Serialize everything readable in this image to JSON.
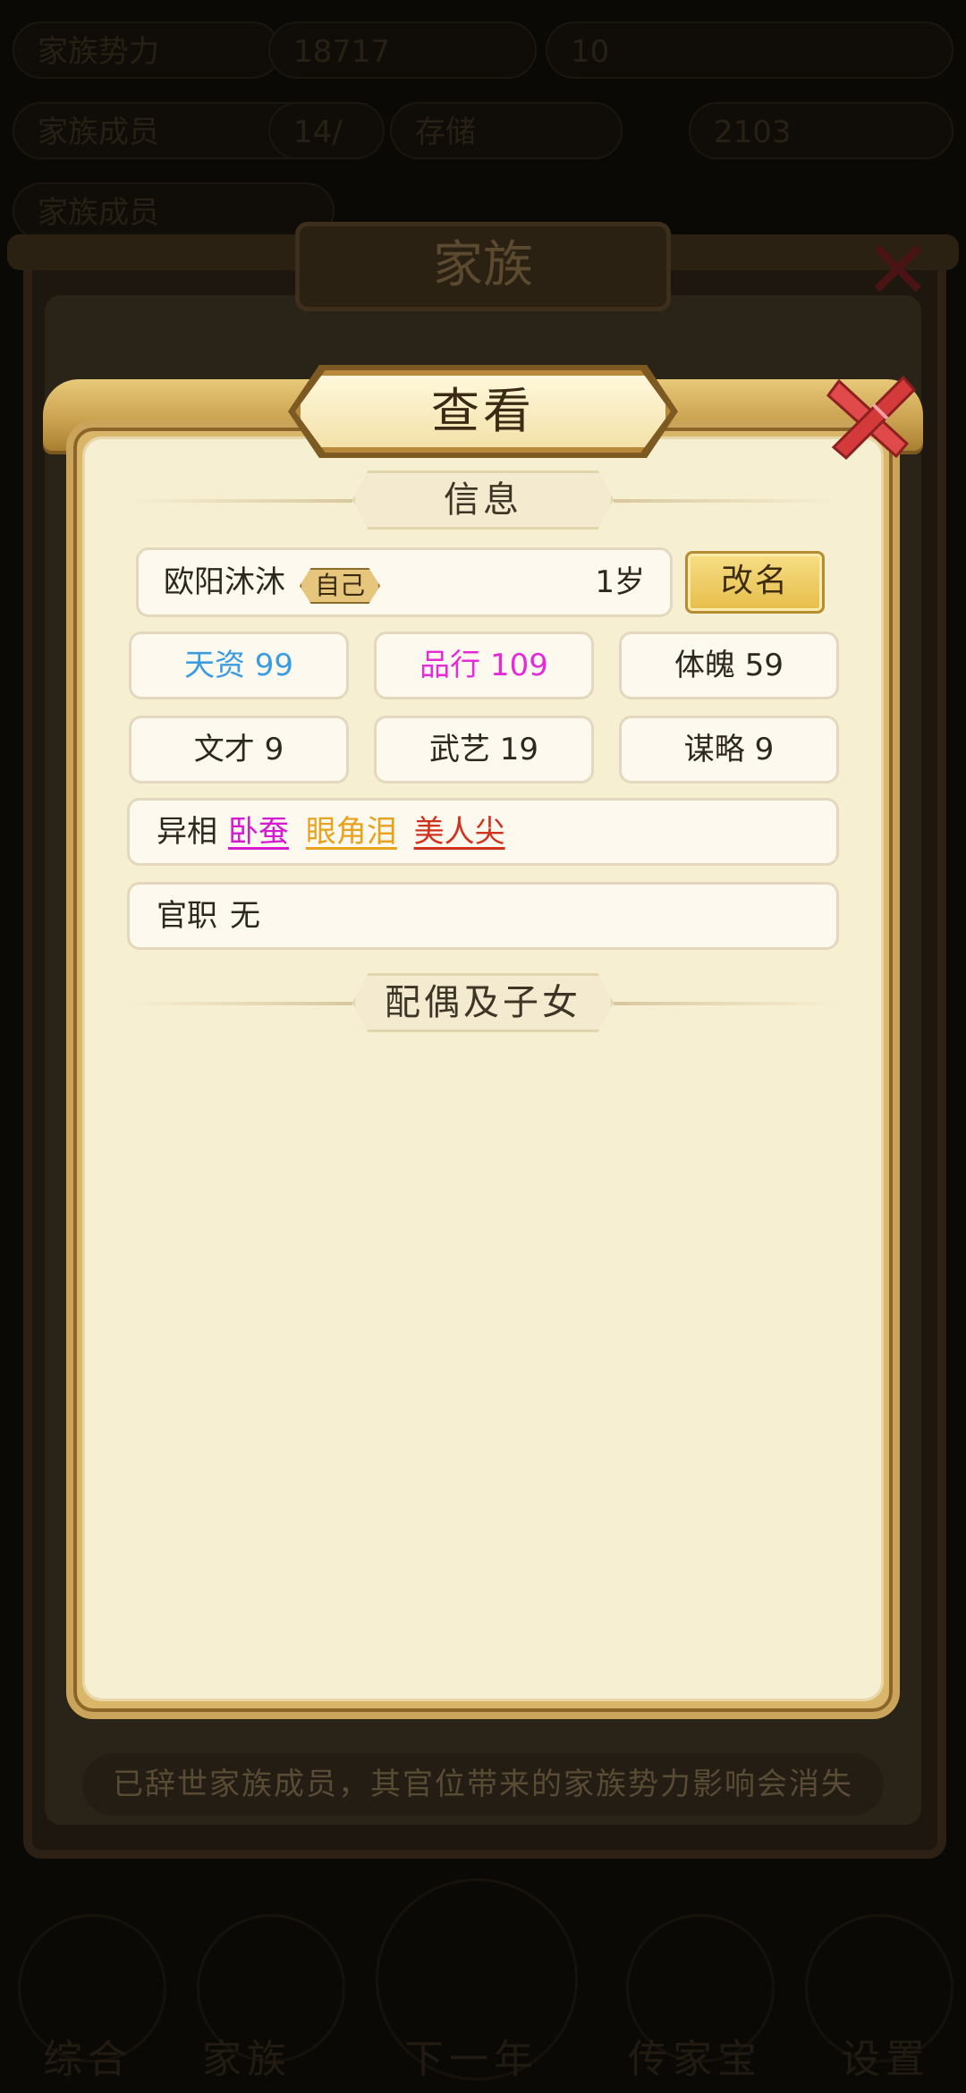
{
  "background": {
    "top_pills": [
      "家族势力",
      "18717",
      "10",
      "家族成员",
      "14/",
      "存储",
      "2103",
      "家族成员"
    ],
    "bottom_nav": [
      "综合",
      "家族",
      "下一年",
      "传家宝",
      "设置"
    ],
    "window_title": "家族",
    "hint": "已辞世家族成员，其官位带来的家族势力影响会消失"
  },
  "dialog": {
    "title": "查看",
    "info_header": "信息",
    "family_header": "配偶及子女",
    "member": {
      "name": "欧阳沐沐",
      "self_badge": "自己",
      "age": "1岁",
      "rename_label": "改名"
    },
    "stats": [
      {
        "label": "天资",
        "value": "99",
        "color": "#3b9ce0"
      },
      {
        "label": "品行",
        "value": "109",
        "color": "#e52ad8"
      },
      {
        "label": "体魄",
        "value": "59",
        "color": "#2e271d"
      },
      {
        "label": "文才",
        "value": "9",
        "color": "#2e271d"
      },
      {
        "label": "武艺",
        "value": "19",
        "color": "#2e271d"
      },
      {
        "label": "谋略",
        "value": "9",
        "color": "#2e271d"
      }
    ],
    "traits_label": "异相",
    "traits": [
      {
        "name": "卧蚕",
        "color": "#d51ad0"
      },
      {
        "name": "眼角泪",
        "color": "#e8a21e"
      },
      {
        "name": "美人尖",
        "color": "#d0321e"
      }
    ],
    "post_label": "官职",
    "post_value": "无"
  }
}
